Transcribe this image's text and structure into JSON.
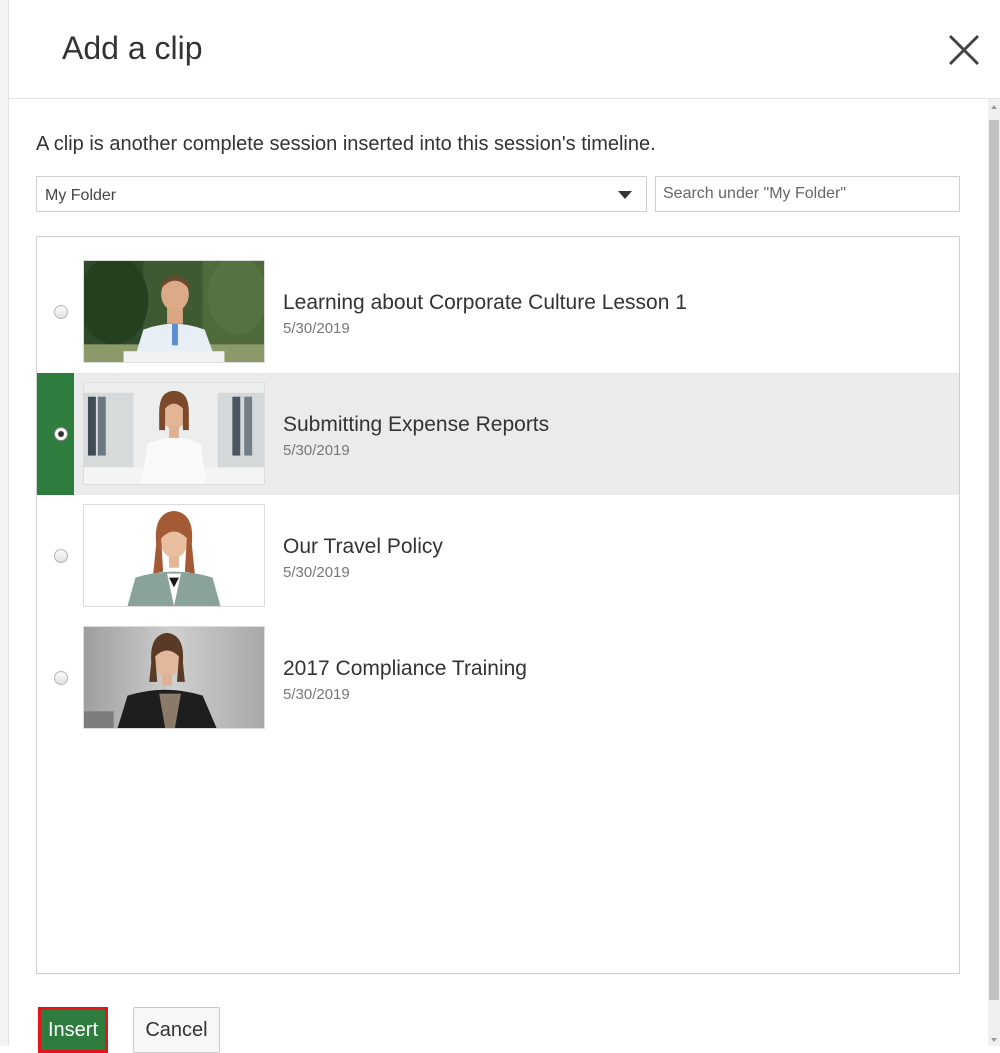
{
  "dialog": {
    "title": "Add a clip",
    "close_icon": "close-icon"
  },
  "description": "A clip is another complete session inserted into this session's timeline.",
  "folder_select": {
    "value": "My Folder",
    "icon": "caret-down-icon"
  },
  "search": {
    "placeholder": "Search under \"My Folder\"",
    "value": ""
  },
  "clips": [
    {
      "title": "Learning about Corporate Culture Lesson 1",
      "date": "5/30/2019",
      "selected": false,
      "thumbnail": "man-in-light-blue-shirt-outdoors"
    },
    {
      "title": "Submitting Expense Reports",
      "date": "5/30/2019",
      "selected": true,
      "thumbnail": "woman-in-white-blouse-office"
    },
    {
      "title": "Our Travel Policy",
      "date": "5/30/2019",
      "selected": false,
      "thumbnail": "woman-in-grey-blazer-white-background"
    },
    {
      "title": "2017 Compliance Training",
      "date": "5/30/2019",
      "selected": false,
      "thumbnail": "woman-in-dark-jacket-grey-background"
    }
  ],
  "buttons": {
    "insert": "Insert",
    "cancel": "Cancel"
  },
  "colors": {
    "accent": "#2e7d3e",
    "highlight_outline": "#e3151a",
    "selected_row": "#ebebeb"
  }
}
